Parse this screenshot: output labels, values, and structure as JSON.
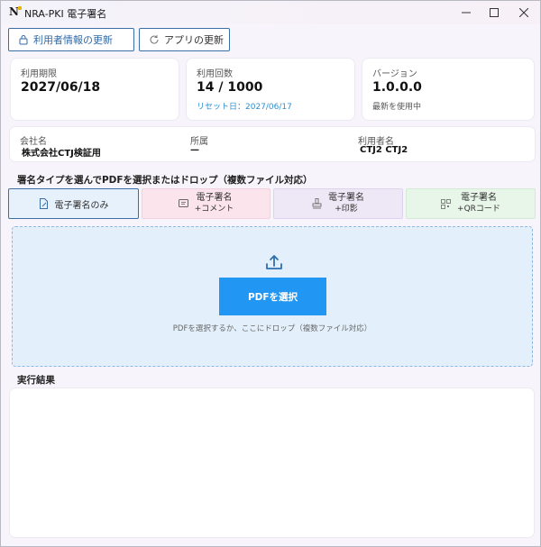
{
  "window": {
    "title": "NRA-PKI 電子署名",
    "logo_letter": "N",
    "controls": {
      "minimize": "—",
      "maximize": "☐",
      "close": "✕"
    }
  },
  "toolbar": {
    "update_user_label": "利用者情報の更新",
    "update_app_label": "アプリの更新"
  },
  "cards": {
    "expiry": {
      "label": "利用期限",
      "value": "2027/06/18"
    },
    "usage": {
      "label": "利用回数",
      "value": "14 / 1000",
      "reset": "リセット日：2027/06/17"
    },
    "version": {
      "label": "バージョン",
      "value": "1.0.0.0",
      "status": "最新を使用中"
    }
  },
  "account": {
    "company_label": "会社名",
    "company_value": "株式会社CTJ検証用",
    "dept_label": "所属",
    "dept_value": "—",
    "user_label": "利用者名",
    "user_value": "CTJ2 CTJ2"
  },
  "signing": {
    "instruction": "署名タイプを選んでPDFを選択またはドロップ（複数ファイル対応）",
    "tabs": [
      {
        "line1": "電子署名のみ",
        "line2": ""
      },
      {
        "line1": "電子署名",
        "line2": "+コメント"
      },
      {
        "line1": "電子署名",
        "line2": "+印影"
      },
      {
        "line1": "電子署名",
        "line2": "+QRコード"
      }
    ]
  },
  "dropzone": {
    "button_label": "PDFを選択",
    "hint": "PDFを選択するか、ここにドロップ（複数ファイル対応）"
  },
  "results": {
    "title": "実行結果"
  },
  "colors": {
    "accent": "#2196f3",
    "border_blue": "#3b6ea5",
    "link": "#2f8fd0",
    "tab_comment": "#fce4ec",
    "tab_stamp": "#ede7f6",
    "tab_qr": "#e8f5e9",
    "drop_bg": "#e3f0fb"
  }
}
